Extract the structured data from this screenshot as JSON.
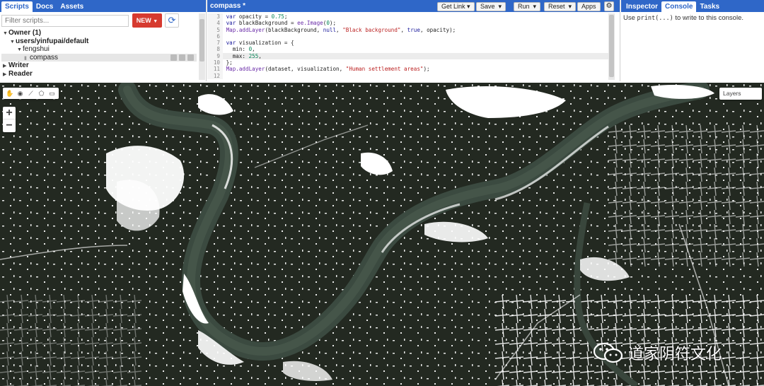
{
  "left_panel": {
    "tabs": [
      {
        "label": "Scripts",
        "active": true
      },
      {
        "label": "Docs",
        "active": false
      },
      {
        "label": "Assets",
        "active": false
      }
    ],
    "filter_placeholder": "Filter scripts...",
    "new_button": "NEW",
    "tree": [
      {
        "label": "Owner (1)",
        "caret": "down",
        "indent": 0,
        "bold": true
      },
      {
        "label": "users/yinfupai/default",
        "caret": "down",
        "indent": 1,
        "bold": true
      },
      {
        "label": "fengshui",
        "caret": "down",
        "indent": 2,
        "bold": false
      },
      {
        "label": "compass",
        "caret": "",
        "indent": 3,
        "bold": false,
        "selected": true,
        "file": true
      },
      {
        "label": "Writer",
        "caret": "right",
        "indent": 0,
        "bold": true
      },
      {
        "label": "Reader",
        "caret": "right",
        "indent": 0,
        "bold": true
      }
    ]
  },
  "editor": {
    "title": "compass *",
    "buttons": [
      "Get Link",
      "Save",
      "Run",
      "Reset",
      "Apps"
    ],
    "lines": [
      {
        "n": "3",
        "code": "var opacity = 0.75;"
      },
      {
        "n": "4",
        "code": "var blackBackground = ee.Image(0);"
      },
      {
        "n": "5",
        "code": "Map.addLayer(blackBackground, null, \"Black background\", true, opacity);"
      },
      {
        "n": "6",
        "code": ""
      },
      {
        "n": "7",
        "code": "var visualization = {"
      },
      {
        "n": "8",
        "code": "  min: 0,"
      },
      {
        "n": "9",
        "code": "  max: 255,",
        "current": true
      },
      {
        "n": "10",
        "code": "};"
      },
      {
        "n": "11",
        "code": "Map.addLayer(dataset, visualization, \"Human settlement areas\");"
      },
      {
        "n": "12",
        "code": ""
      }
    ]
  },
  "right_panel": {
    "tabs": [
      {
        "label": "Inspector",
        "active": false
      },
      {
        "label": "Console",
        "active": true
      },
      {
        "label": "Tasks",
        "active": false
      }
    ],
    "console_pre": "Use ",
    "console_code": "print(...)",
    "console_post": " to write to this console."
  },
  "map": {
    "layers_label": "Layers",
    "zoom_in": "+",
    "zoom_out": "−",
    "watermark": "道家阴符文化",
    "colors": {
      "land": "#1f261f",
      "river": "#3b4a40",
      "settlement": "#ffffff",
      "accent": "#2f67c8"
    }
  }
}
